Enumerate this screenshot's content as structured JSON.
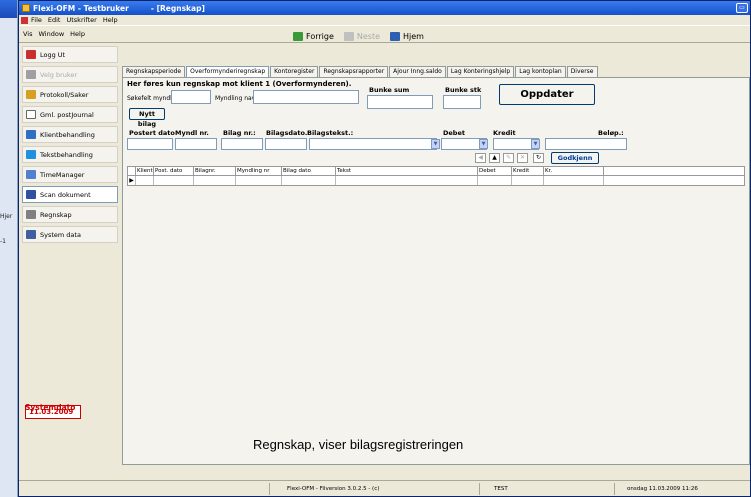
{
  "background_window": {
    "fragments": [
      "Hjer",
      "-1"
    ]
  },
  "window": {
    "title": "Flexi-OFM - Testbruker",
    "document_title": "- [Regnskap]"
  },
  "menubar1": {
    "items": [
      "File",
      "Edit",
      "Utskrifter",
      "Help"
    ]
  },
  "menubar2": {
    "items": [
      "Vis",
      "Window",
      "Help"
    ]
  },
  "toolbar": {
    "back_label": "Forrige",
    "next_label": "Neste",
    "home_label": "Hjem"
  },
  "nav": {
    "items": [
      {
        "label": "Logg Ut",
        "color": "#c83030"
      },
      {
        "label": "Velg bruker",
        "color": "#a0a0a0"
      },
      {
        "label": "Protokoll/Saker",
        "color": "#d8a020"
      },
      {
        "label": "Gml. postJournal",
        "color": "#ffffff"
      },
      {
        "label": "Klientbehandling",
        "color": "#3070c0"
      },
      {
        "label": "Tekstbehandling",
        "color": "#2090e0"
      },
      {
        "label": "TimeManager",
        "color": "#5080d0"
      },
      {
        "label": "Scan dokument",
        "color": "#3050a0"
      },
      {
        "label": "Regnskap",
        "color": "#808080"
      },
      {
        "label": "System data",
        "color": "#4060a0"
      }
    ],
    "systemdato_label": "Systemdato",
    "systemdato_value": "11.03.2009"
  },
  "tabs": [
    "Regnskapsperiode",
    "Overformynderiregnskap",
    "Kontoregister",
    "Regnskapsrapporter",
    "Ajour Inng.saldo",
    "Lag Konteringshjelp",
    "Lag kontoplan",
    "Diverse"
  ],
  "form": {
    "heading": "Her føres kun regnskap mot klient 1 (Overformynderen).",
    "search_label": "Søkefelt myndling.:",
    "myndling_name_label": "Myndling navn.:",
    "bunke_sum_label": "Bunke sum",
    "bunke_stk_label": "Bunke stk",
    "oppdater_label": "Oppdater",
    "nytt_bilag_label": "Nytt bilag",
    "postert_dato_label": "Postert dato",
    "myndl_nr_label": "Myndl nr.",
    "bilag_nr_label": "Bilag nr.:",
    "bilagsdato_label": "Bilagsdato.:",
    "bilagstekst_label": "Bilagstekst.:",
    "debet_label": "Debet",
    "kredit_label": "Kredit",
    "belop_label": "Beløp.:",
    "godkjenn_label": "Godkjenn"
  },
  "grid": {
    "columns": [
      "Klient",
      "Post. dato",
      "Bilagnr.",
      "Myndling nr",
      "Bilag dato",
      "Tekst",
      "Debet",
      "Kredit",
      "Kr."
    ]
  },
  "caption": "Regnskap, viser bilagsregistreringen",
  "status": {
    "version": "Flexi-OFM - Filversion 3.0.2.5 - (c)",
    "mode": "TEST",
    "datetime": "onsdag 11.03.2009 11:26"
  }
}
